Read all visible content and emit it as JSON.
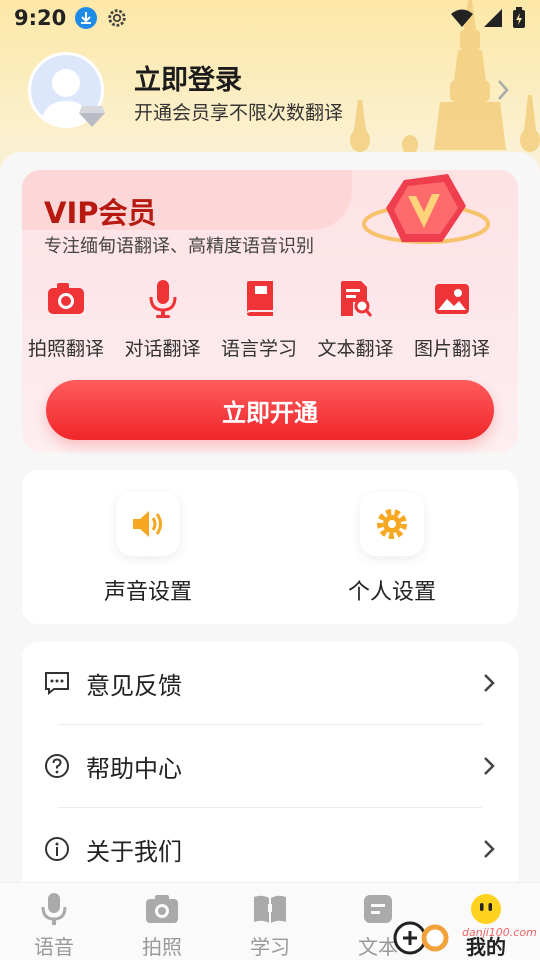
{
  "status_bar": {
    "time": "9:20"
  },
  "profile": {
    "title": "立即登录",
    "subtitle": "开通会员享不限次数翻译"
  },
  "vip": {
    "title": "VIP会员",
    "subtitle": "专注缅甸语翻译、高精度语音识别",
    "features": [
      {
        "label": "拍照翻译",
        "icon": "camera-icon"
      },
      {
        "label": "对话翻译",
        "icon": "microphone-icon"
      },
      {
        "label": "语言学习",
        "icon": "book-icon"
      },
      {
        "label": "文本翻译",
        "icon": "document-search-icon"
      },
      {
        "label": "图片翻译",
        "icon": "image-icon"
      }
    ],
    "button_label": "立即开通",
    "accent": "#f0262a"
  },
  "settings": {
    "sound": "声音设置",
    "personal": "个人设置"
  },
  "menu": {
    "items": [
      {
        "label": "意见反馈",
        "icon": "feedback-icon"
      },
      {
        "label": "帮助中心",
        "icon": "help-icon"
      },
      {
        "label": "关于我们",
        "icon": "info-icon"
      }
    ]
  },
  "bottom_nav": {
    "items": [
      {
        "label": "语音",
        "icon": "microphone-icon"
      },
      {
        "label": "拍照",
        "icon": "camera-icon"
      },
      {
        "label": "学习",
        "icon": "book-icon"
      },
      {
        "label": "文本",
        "icon": "text-icon"
      },
      {
        "label": "我的",
        "icon": "profile-face-icon",
        "active": true
      }
    ]
  },
  "watermark": {
    "text": "danji100.com"
  }
}
